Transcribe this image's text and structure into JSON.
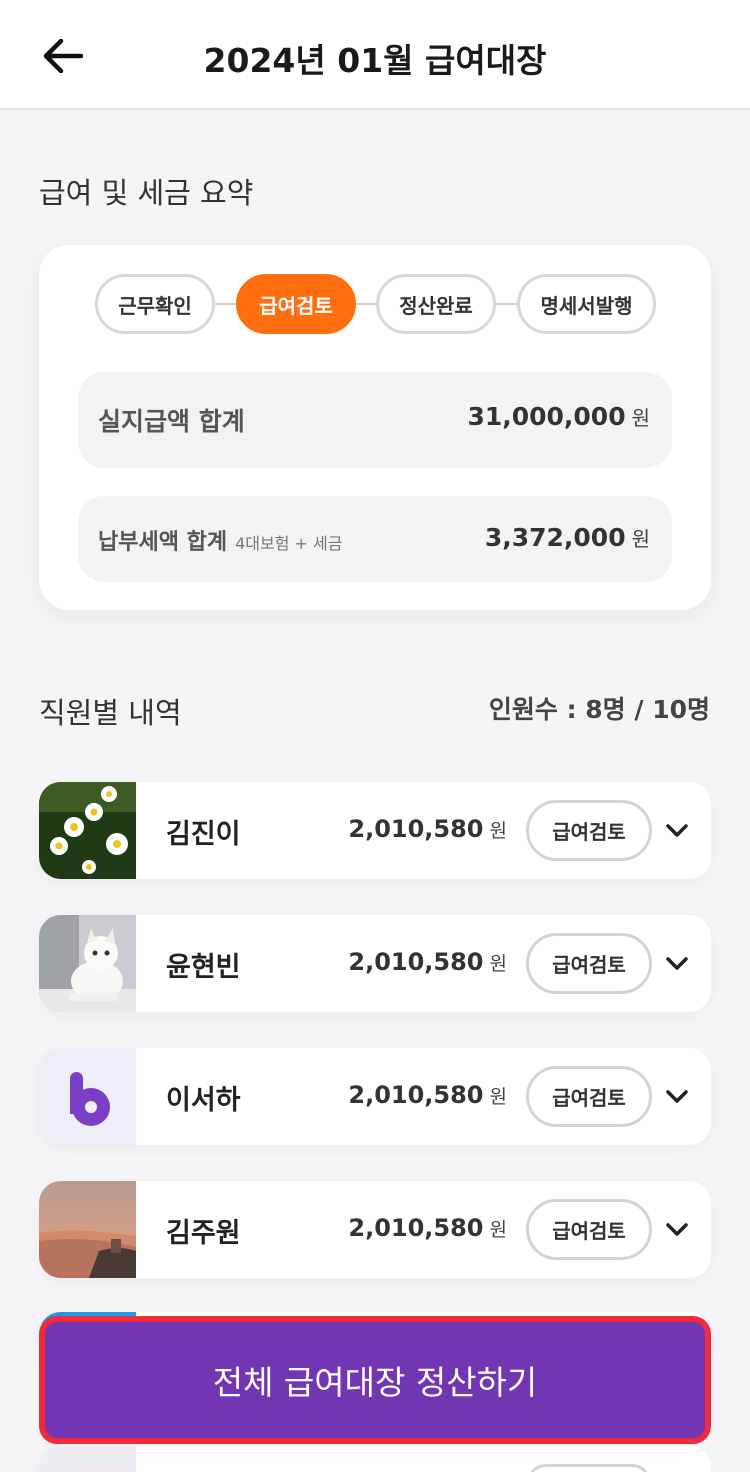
{
  "header": {
    "title": "2024년 01월 급여대장",
    "back_icon": "arrow-left-icon"
  },
  "summary": {
    "section_title": "급여 및 세금 요약",
    "steps": [
      {
        "label": "근무확인",
        "active": false
      },
      {
        "label": "급여검토",
        "active": true
      },
      {
        "label": "정산완료",
        "active": false
      },
      {
        "label": "명세서발행",
        "active": false
      }
    ],
    "net_pay": {
      "label": "실지급액 합계",
      "amount": "31,000,000",
      "unit": "원"
    },
    "tax": {
      "label": "납부세액 합계",
      "sub": "4대보험 + 세금",
      "amount": "3,372,000",
      "unit": "원"
    }
  },
  "employees": {
    "section_title": "직원별 내역",
    "count_text": "인원수 : 8명 / 10명",
    "items": [
      {
        "name": "김진이",
        "amount": "2,010,580",
        "unit": "원",
        "status": "급여검토",
        "photo": "daisy-flowers-photo"
      },
      {
        "name": "윤현빈",
        "amount": "2,010,580",
        "unit": "원",
        "status": "급여검토",
        "photo": "white-cat-photo"
      },
      {
        "name": "이서하",
        "amount": "2,010,580",
        "unit": "원",
        "status": "급여검토",
        "photo": "purple-b-logo"
      },
      {
        "name": "김주원",
        "amount": "2,010,580",
        "unit": "원",
        "status": "급여검토",
        "photo": "beach-sunset-photo"
      }
    ]
  },
  "cta": {
    "label": "전체 급여대장 정산하기"
  },
  "colors": {
    "accent_orange": "#ff6f0f",
    "cta_purple": "#7336b2",
    "highlight_red": "#ee2c3c"
  }
}
